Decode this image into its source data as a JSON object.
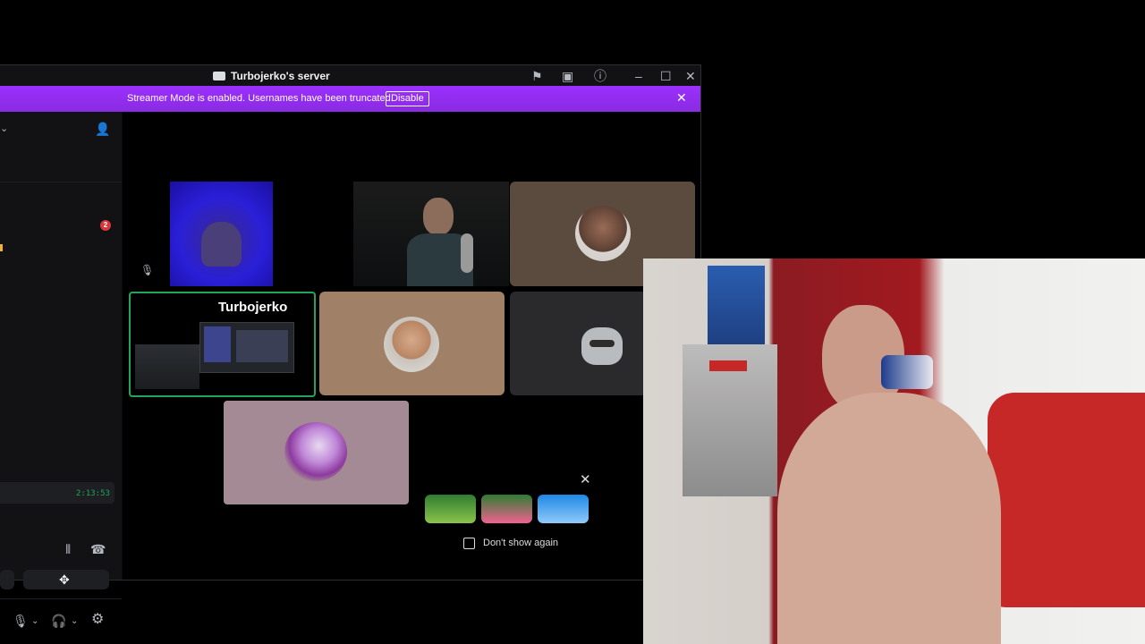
{
  "window": {
    "title": "Turbojerko's server",
    "banner_text": "Streamer Mode is enabled. Usernames have been truncated.",
    "banner_button": "Disable"
  },
  "sidebar": {
    "badge_count": "2",
    "call_timer": "2:13:53"
  },
  "call": {
    "screenshare_name": "Turbojerko",
    "dont_show_label": "Don't show again"
  },
  "colors": {
    "banner": "#8a2be2",
    "speaking_border": "#23a559",
    "tile_tan": "#a08066",
    "tile_brown": "#5b4a3e",
    "tile_mauve": "#a38a94"
  }
}
